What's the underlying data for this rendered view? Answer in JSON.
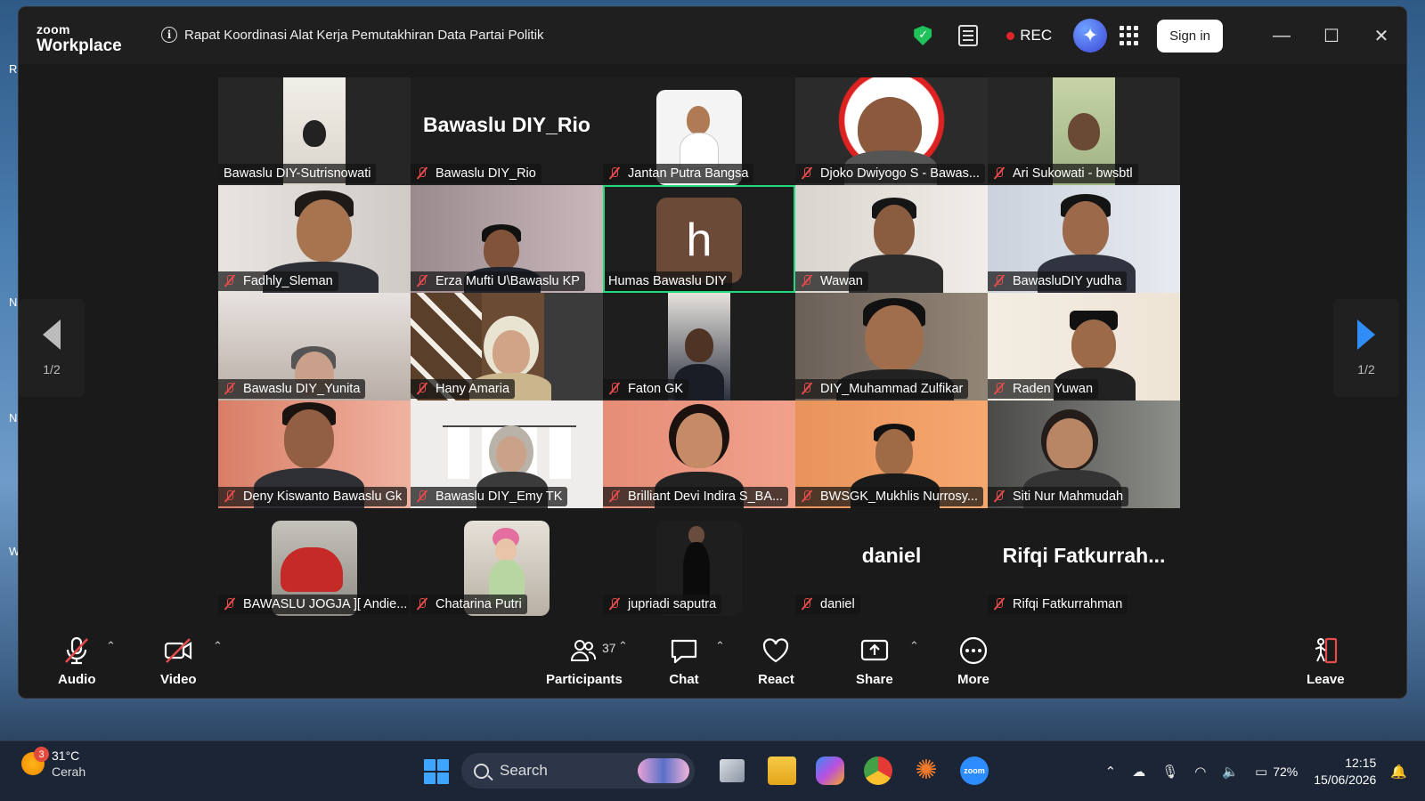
{
  "window": {
    "brand_line1": "zoom",
    "brand_line2": "Workplace",
    "meeting_title": "Rapat Koordinasi Alat Kerja Pemutakhiran Data Partai Politik",
    "rec_label": "REC",
    "signin_label": "Sign in"
  },
  "gallery": {
    "page_left": "1/2",
    "page_right": "1/2",
    "participants": [
      {
        "name": "Bawaslu DIY-Sutrisnowati",
        "muted": false
      },
      {
        "name": "Bawaslu DIY_Rio",
        "muted": true,
        "big": "Bawaslu DIY_Rio"
      },
      {
        "name": "Jantan Putra Bangsa",
        "muted": true
      },
      {
        "name": "Djoko Dwiyogo S - Bawas...",
        "muted": true
      },
      {
        "name": "Ari Sukowati -  bwsbtl",
        "muted": true
      },
      {
        "name": "Fadhly_Sleman",
        "muted": true
      },
      {
        "name": "Erza Mufti U\\Bawaslu KP",
        "muted": true
      },
      {
        "name": "Humas Bawaslu DIY",
        "muted": false,
        "avatar": "h",
        "active": true
      },
      {
        "name": "Wawan",
        "muted": true
      },
      {
        "name": "BawasluDIY yudha",
        "muted": true
      },
      {
        "name": "Bawaslu DIY_Yunita",
        "muted": true
      },
      {
        "name": "Hany Amaria",
        "muted": true
      },
      {
        "name": "Faton GK",
        "muted": true
      },
      {
        "name": "DIY_Muhammad Zulfikar",
        "muted": true
      },
      {
        "name": "Raden Yuwan",
        "muted": true
      },
      {
        "name": "Deny Kiswanto Bawaslu Gk",
        "muted": true
      },
      {
        "name": "Bawaslu DIY_Emy  TK",
        "muted": true
      },
      {
        "name": "Brilliant Devi Indira S_BA...",
        "muted": true
      },
      {
        "name": "BWSGK_Mukhlis Nurrosy...",
        "muted": true
      },
      {
        "name": "Siti Nur Mahmudah",
        "muted": true
      },
      {
        "name": "BAWASLU JOGJA ][ Andie...",
        "muted": true
      },
      {
        "name": "Chatarina Putri",
        "muted": true
      },
      {
        "name": "jupriadi saputra",
        "muted": true
      },
      {
        "name": "daniel",
        "muted": true,
        "big": "daniel"
      },
      {
        "name": "Rifqi Fatkurrahman",
        "muted": true,
        "big": "Rifqi  Fatkurrah..."
      }
    ]
  },
  "toolbar": {
    "audio": "Audio",
    "video": "Video",
    "participants": "Participants",
    "participants_count": "37",
    "chat": "Chat",
    "react": "React",
    "share": "Share",
    "more": "More",
    "leave": "Leave"
  },
  "taskbar": {
    "weather_temp": "31°C",
    "weather_desc": "Cerah",
    "weather_badge": "3",
    "search_label": "Search",
    "battery": "72%",
    "time": "12:15",
    "date": "15/06/2026"
  },
  "colors": {
    "accent_blue": "#2f8df5",
    "active_green": "#23d97d",
    "muted_red": "#e74c4c"
  }
}
